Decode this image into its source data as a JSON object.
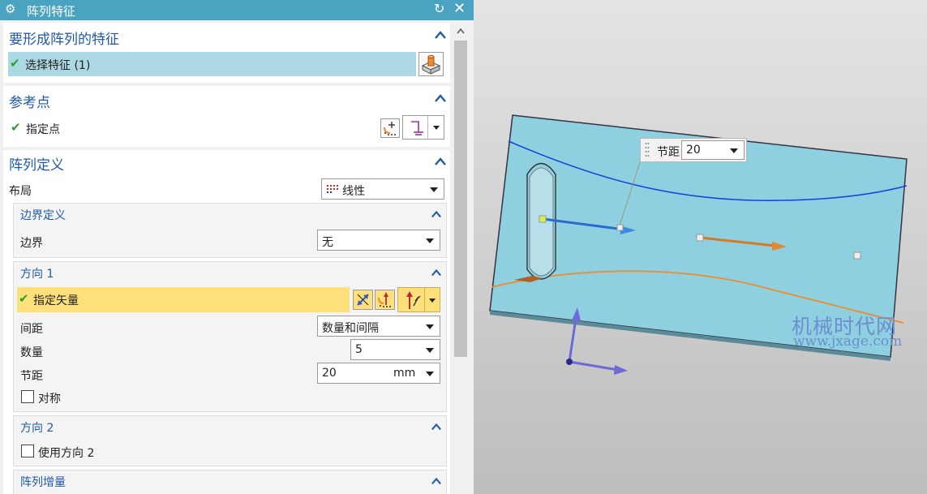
{
  "dialog": {
    "title": "阵列特征",
    "icons": {
      "settings": "gear-icon",
      "reset": "reset-icon",
      "close": "close-icon"
    }
  },
  "feature_section": {
    "title": "要形成阵列的特征",
    "select_label": "选择特征 (1)",
    "button_icon": "feature-solid-icon"
  },
  "ref_section": {
    "title": "参考点",
    "point_label": "指定点"
  },
  "array_section": {
    "title": "阵列定义",
    "layout_label": "布局",
    "layout_value": "线性",
    "boundary": {
      "title": "边界定义",
      "label": "边界",
      "value": "无"
    },
    "direction1": {
      "title": "方向 1",
      "vector_label": "指定矢量",
      "spacing_label": "间距",
      "spacing_value": "数量和间隔",
      "count_label": "数量",
      "count_value": "5",
      "pitch_label": "节距",
      "pitch_value": "20",
      "pitch_unit": "mm",
      "symmetric_label": "对称"
    },
    "direction2": {
      "title": "方向 2",
      "use_label": "使用方向 2"
    },
    "increment_title": "阵列增量"
  },
  "viewport": {
    "pitch_label": "节距",
    "pitch_value": "20",
    "watermark_cn": "机械时代网",
    "watermark_url": "www.jxage.com"
  },
  "colors": {
    "titlebar": "#4aa3c1",
    "section_title": "#1f5aa6",
    "selected_row": "#acd8e3",
    "highlight_row": "#fde07a",
    "plate": "#8ecfe0"
  }
}
